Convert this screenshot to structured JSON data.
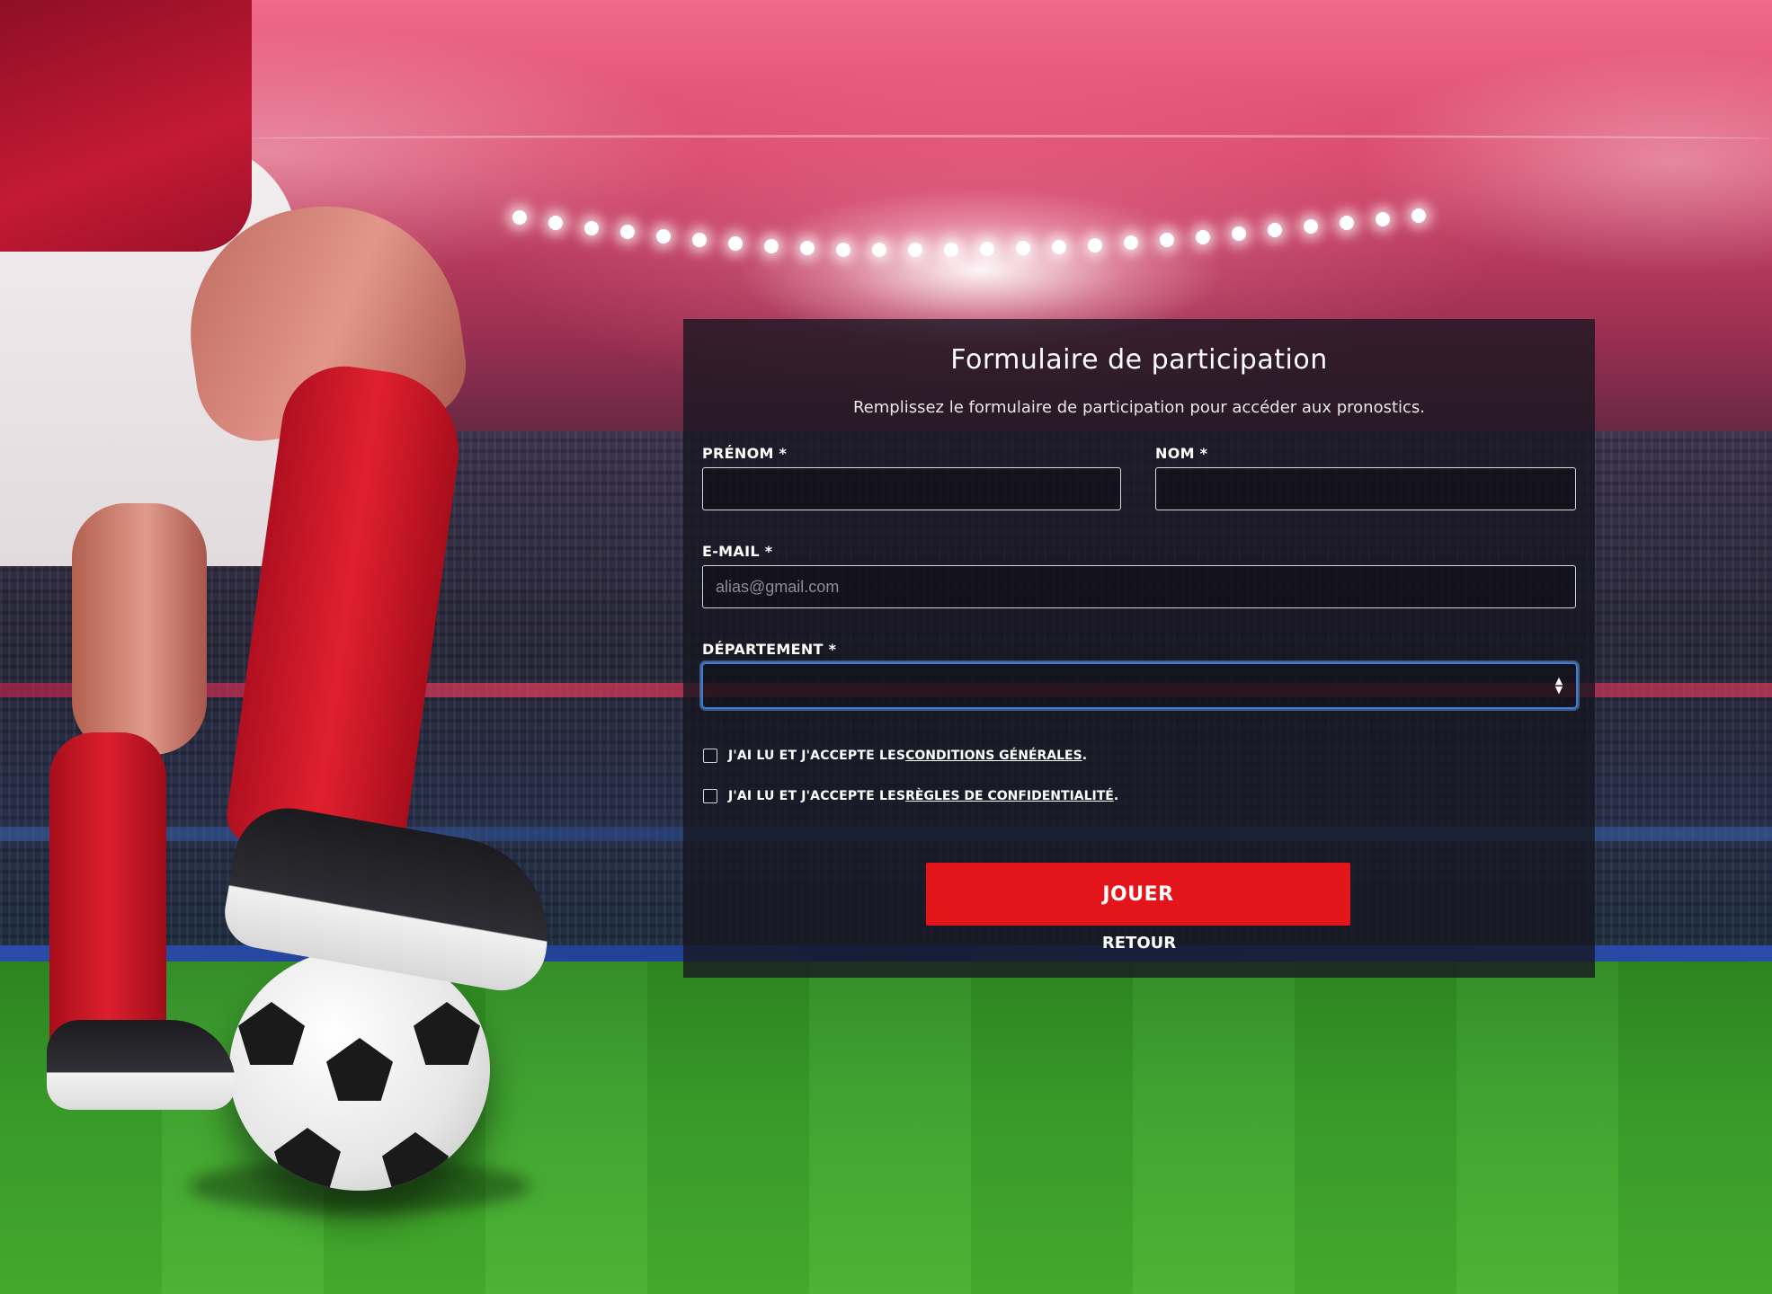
{
  "form": {
    "title": "Formulaire de participation",
    "subtitle": "Remplissez le formulaire de participation pour accéder aux pronostics.",
    "first_name": {
      "label": "PRÉNOM *",
      "value": "",
      "placeholder": ""
    },
    "last_name": {
      "label": "NOM *",
      "value": "",
      "placeholder": ""
    },
    "email": {
      "label": "E-MAIL *",
      "value": "",
      "placeholder": "alias@gmail.com"
    },
    "department": {
      "label": "DÉPARTEMENT *",
      "selected": ""
    },
    "terms": {
      "prefix": "J'AI LU ET J'ACCEPTE LES ",
      "link": "CONDITIONS GÉNÉRALES",
      "suffix": "."
    },
    "privacy": {
      "prefix": "J'AI LU ET J'ACCEPTE LES ",
      "link": "RÈGLES DE CONFIDENTIALITÉ",
      "suffix": "."
    },
    "submit_label": "JOUER",
    "back_label": "RETOUR"
  },
  "theme": {
    "accent": "#e3151a",
    "focus": "#3b7dd8",
    "panel_bg": "#16161f"
  },
  "icons": {
    "select": "updown-arrows-icon"
  }
}
